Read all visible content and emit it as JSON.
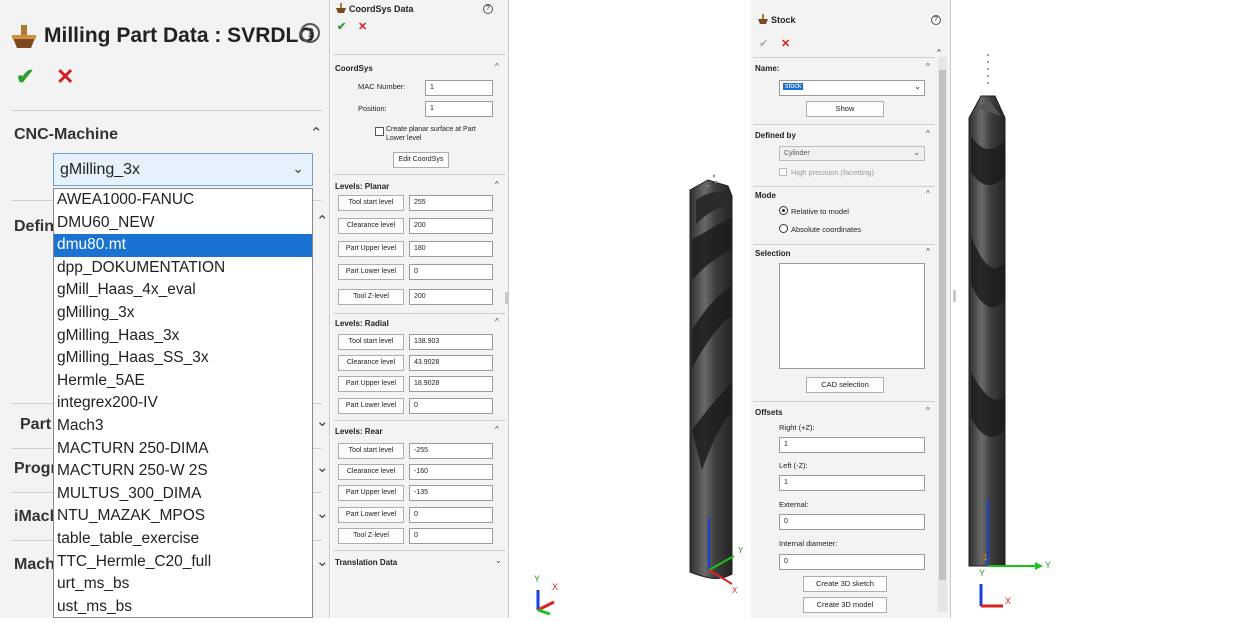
{
  "milling_panel": {
    "title": "Milling Part Data : SVRDLO",
    "help_icon": "?",
    "ok_icon": "✔",
    "cancel_icon": "✕",
    "sections": {
      "cnc_machine": "CNC-Machine",
      "defin": "Defin",
      "part": "Part",
      "progr": "Progr",
      "imach": "iMach",
      "mach": "Mach"
    },
    "selected_machine": "gMilling_3x",
    "machine_options": [
      "AWEA1000-FANUC",
      "DMU60_NEW",
      "dmu80.mt",
      "dpp_DOKUMENTATION",
      "gMill_Haas_4x_eval",
      "gMilling_3x",
      "gMilling_Haas_3x",
      "gMilling_Haas_SS_3x",
      "Hermle_5AE",
      "integrex200-IV",
      "Mach3",
      "MACTURN 250-DIMA",
      "MACTURN 250-W 2S",
      "MULTUS_300_DIMA",
      "NTU_MAZAK_MPOS",
      "table_table_exercise",
      "TTC_Hermle_C20_full",
      "urt_ms_bs",
      "ust_ms_bs"
    ],
    "highlighted_option": "dmu80.mt"
  },
  "coordsys_panel": {
    "title": "CoordSys Data",
    "help_icon": "?",
    "ok_icon": "✔",
    "cancel_icon": "✕",
    "coordsys": {
      "header": "CoordSys",
      "mac_number_label": "MAC Number:",
      "mac_number_value": "1",
      "position_label": "Position:",
      "position_value": "1",
      "planar_surface_label_1": "Create planar surface at Part",
      "planar_surface_label_2": "Lower level",
      "edit_button": "Edit CoordSys"
    },
    "planar": {
      "header": "Levels: Planar",
      "rows": [
        {
          "label": "Tool start level",
          "value": "255"
        },
        {
          "label": "Clearance level",
          "value": "200"
        },
        {
          "label": "Part Upper level",
          "value": "180"
        },
        {
          "label": "Part Lower level",
          "value": "0"
        },
        {
          "label": "Tool Z-level",
          "value": "200"
        }
      ]
    },
    "radial": {
      "header": "Levels: Radial",
      "rows": [
        {
          "label": "Tool start level",
          "value": "138.903"
        },
        {
          "label": "Clearance level",
          "value": "43.9028"
        },
        {
          "label": "Part Upper level",
          "value": "18.9028"
        },
        {
          "label": "Part Lower level",
          "value": "0"
        }
      ]
    },
    "rear": {
      "header": "Levels: Rear",
      "rows": [
        {
          "label": "Tool start level",
          "value": "-255"
        },
        {
          "label": "Clearance level",
          "value": "-160"
        },
        {
          "label": "Part Upper level",
          "value": "-135"
        },
        {
          "label": "Part Lower level",
          "value": "0"
        },
        {
          "label": "Tool Z-level",
          "value": "0"
        }
      ]
    },
    "translation_header": "Translation Data"
  },
  "stock_panel": {
    "title": "Stock",
    "help_icon": "?",
    "ok_icon": "✔",
    "cancel_icon": "✕",
    "name_header": "Name:",
    "name_value": "stock",
    "show_button": "Show",
    "defined_by_header": "Defined by",
    "defined_by_value": "Cylinder",
    "high_precision_label": "High precision (facetting)",
    "mode_header": "Mode",
    "mode_relative": "Relative to model",
    "mode_absolute": "Absolute coordinates",
    "selection_header": "Selection",
    "cad_selection_button": "CAD selection",
    "offsets_header": "Offsets",
    "right_label": "Right (+Z):",
    "right_value": "1",
    "left_label": "Left (-Z):",
    "left_value": "1",
    "external_label": "External:",
    "external_value": "0",
    "internal_label": "Internal diameter:",
    "internal_value": "0",
    "create_sketch_button": "Create 3D sketch",
    "create_model_button": "Create 3D model"
  },
  "viewport": {
    "axis_y": "Y",
    "axis_x": "X",
    "triad_y": "Y",
    "triad_x": "X"
  },
  "colors": {
    "accent_blue": "#1a73d2",
    "ok_green": "#2e9e2e",
    "cancel_red": "#d42020",
    "panel_bg": "#f3f3f3",
    "drill_gray": "#505050"
  }
}
